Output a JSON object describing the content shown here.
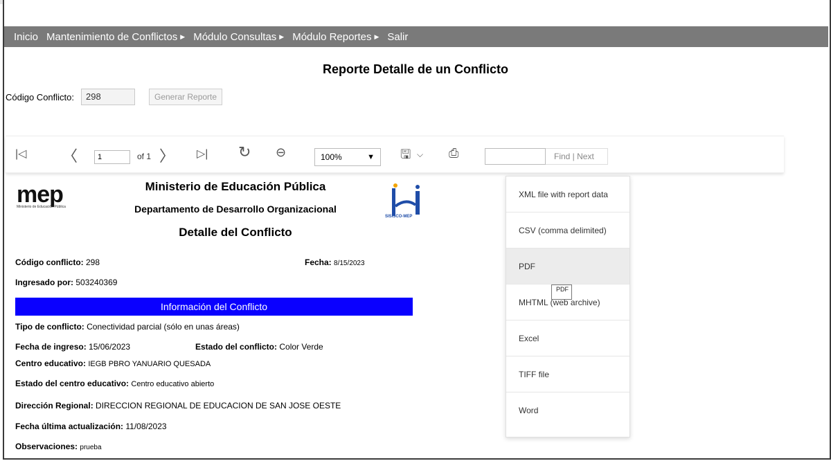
{
  "nav": {
    "items": [
      {
        "label": "Inicio",
        "arrow": false
      },
      {
        "label": "Mantenimiento de Conflictos",
        "arrow": true
      },
      {
        "label": "Módulo Consultas",
        "arrow": true
      },
      {
        "label": "Módulo Reportes",
        "arrow": true
      },
      {
        "label": "Salir",
        "arrow": false
      }
    ]
  },
  "page": {
    "title": "Reporte Detalle de un Conflicto"
  },
  "form": {
    "code_label": "Código Conflicto:",
    "code_value": "298",
    "generate_label": "Generar Reporte"
  },
  "toolbar": {
    "page_value": "1",
    "of_label": "of 1",
    "zoom": "100%",
    "find_label": "Find | Next"
  },
  "report": {
    "logo_text": "mep",
    "logo_sub": "Ministerio de Educación Pública",
    "ministry": "Ministerio de Educación Pública",
    "department": "Departamento de Desarrollo Organizacional",
    "doc_title": "Detalle del Conflicto",
    "sisisco": "SISISCO-MEP",
    "code_label": "Código conflicto:",
    "code_value": "298",
    "date_label": "Fecha:",
    "date_value": "8/15/2023",
    "entered_label": "Ingresado por:",
    "entered_value": "503240369",
    "section_title": "Información del Conflicto",
    "type_label": "Tipo de conflicto:",
    "type_value": "Conectividad parcial (sólo en unas áreas)",
    "entry_label": "Fecha de ingreso:",
    "entry_value": "15/06/2023",
    "status_label": "Estado del conflicto:",
    "status_value": "Color Verde",
    "school_label": "Centro educativo:",
    "school_value": "IEGB PBRO YANUARIO QUESADA",
    "school_status_label": "Estado del centro educativo:",
    "school_status_value": "Centro educativo abierto",
    "region_label": "Dirección Regional:",
    "region_value": "DIRECCION REGIONAL DE EDUCACION DE SAN JOSE OESTE",
    "updated_label": "Fecha última actualización:",
    "updated_value": "11/08/2023",
    "notes_label": "Observaciones:",
    "notes_value": "prueba"
  },
  "export_menu": {
    "items": [
      "XML file with report data",
      "CSV (comma delimited)",
      "PDF",
      "MHTML (web archive)",
      "Excel",
      "TIFF file",
      "Word"
    ],
    "tooltip": "PDF"
  },
  "colors": {
    "navbar": "#7a7a7a",
    "section_bar": "#0a00ff"
  }
}
